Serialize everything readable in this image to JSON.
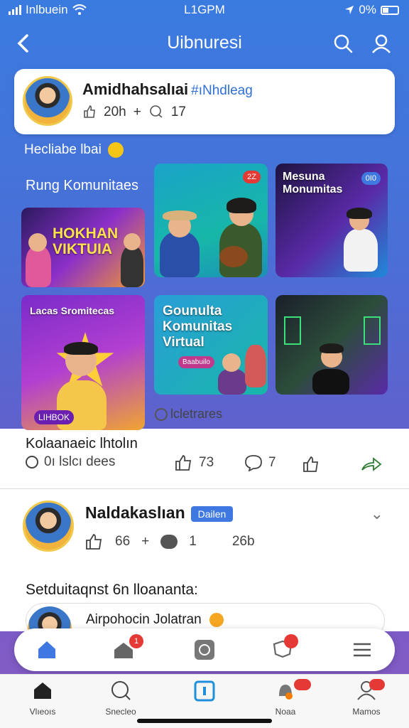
{
  "status_bar": {
    "carrier": "Inlbuein",
    "time": "L1GPM",
    "battery": "0%"
  },
  "nav": {
    "title": "Uibnuresi"
  },
  "profile": {
    "name": "Amidhahsalıai",
    "hashtag": "#ıNhdleag",
    "likes": "20h",
    "plus": "+",
    "comments": "17"
  },
  "section_label_top": "Hecliabe lbai",
  "community": {
    "label": "Rung Komunitaes",
    "tiles": [
      {
        "title": "HOKHAN VIKTUIA"
      },
      {
        "badge": "2Z"
      },
      {
        "title": "Mesuna Monumitas",
        "badge": "0I0"
      },
      {
        "title": "Lacas Sromitecas",
        "badge": "LIHBOK"
      },
      {
        "title": "Gounulta Komunitas Virtual",
        "sub": "Baabuilo"
      },
      {
        "title": ""
      }
    ],
    "meta": "lcletrares"
  },
  "post1": {
    "caption": "Kolaanaeic lhtolın",
    "time": "0ı lslcı dees",
    "likes": "73",
    "comments": "7"
  },
  "post2": {
    "name": "Naldakaslıan",
    "tag": "Dailen",
    "likes": "66",
    "plus": "+",
    "shares": "1",
    "time": "26b",
    "subtitle": "Setduitaqnst 6n lloananta:",
    "comment_text": "Airpohocin Jolatran"
  },
  "action_bar": {
    "badge_1": "1"
  },
  "tabs": [
    {
      "label": "Vlıeoıs"
    },
    {
      "label": "Snecleo"
    },
    {
      "label": ""
    },
    {
      "label": "Noaa"
    },
    {
      "label": "Mamos"
    }
  ],
  "colors": {
    "accent": "#2f6fd6",
    "badge_red": "#e53935",
    "tag_blue": "#3f78e0"
  }
}
